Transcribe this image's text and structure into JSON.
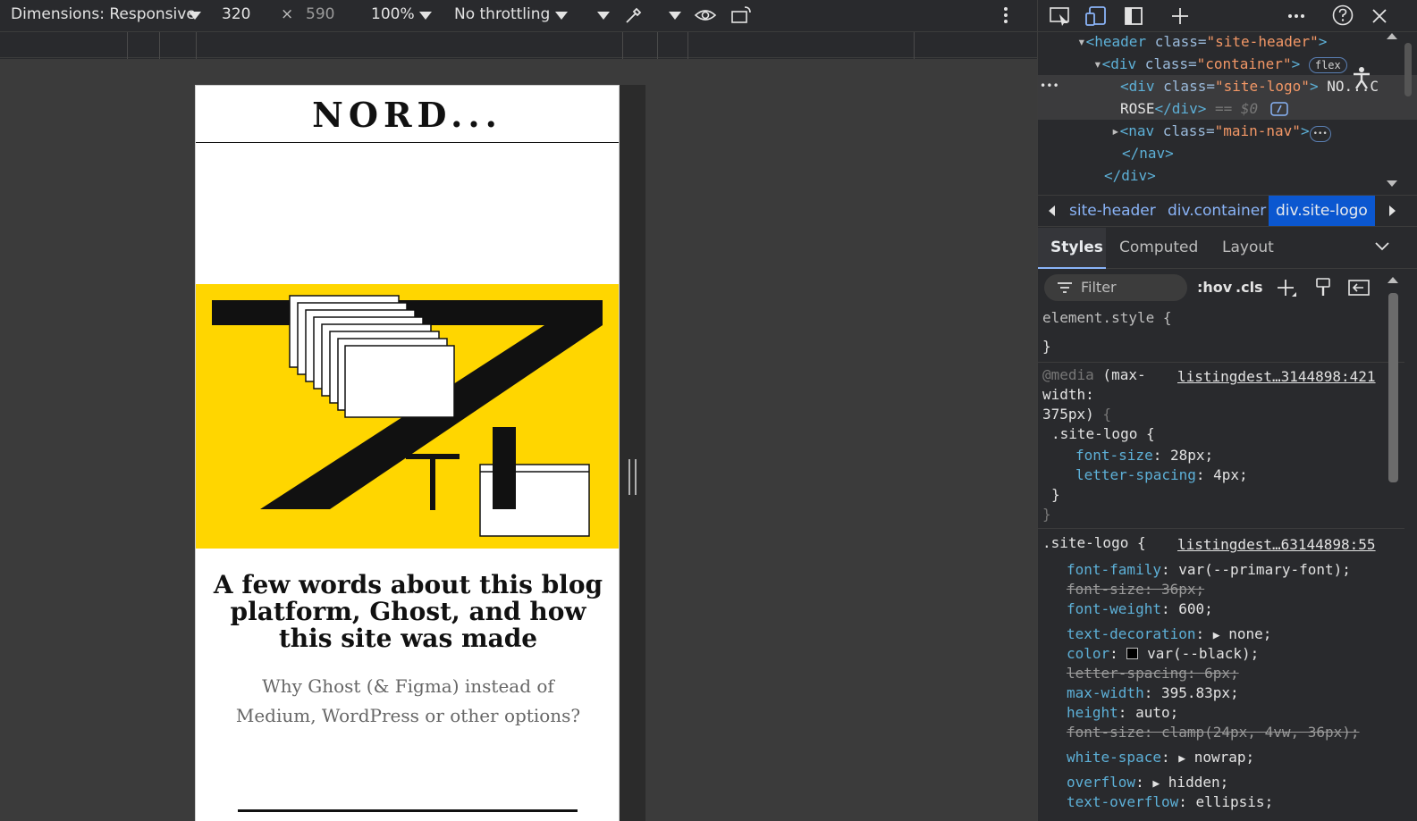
{
  "device_toolbar": {
    "dimensions_label": "Dimensions: Responsive",
    "width_value": "320",
    "times": "×",
    "height_value": "590",
    "zoom": "100%",
    "throttling": "No throttling"
  },
  "page": {
    "logo": "NORD...",
    "post_title": "A few words about this blog platform, Ghost, and how this site was made",
    "post_subtitle": "Why Ghost (& Figma) instead of Medium, WordPress or other options?"
  },
  "devtools": {
    "elements": {
      "line1_tag": "<header",
      "line1_attr": " class=",
      "line1_val": "\"site-header\"",
      "line1_end": ">",
      "line2_tag": "<div",
      "line2_attr": " class=",
      "line2_val": "\"container\"",
      "line2_end": ">",
      "line2_badge": "flex",
      "line3_tag": "<div",
      "line3_attr": " class=",
      "line3_val": "\"site-logo\"",
      "line3_end": ">",
      "line3_text": " NO...C",
      "line4_text": "ROSE",
      "line4_close": "</div>",
      "line4_eq": " == $0",
      "line5_tag": "<nav",
      "line5_attr": " class=",
      "line5_val": "\"main-nav\"",
      "line5_end": ">",
      "line5_badge": "•••",
      "line6_close": "</nav>",
      "line7_close": "</div>",
      "gutter_dots": "•••"
    },
    "breadcrumbs": [
      "site-header",
      "div.container",
      "div.site-logo"
    ],
    "style_tabs": [
      "Styles",
      "Computed",
      "Layout"
    ],
    "filter_placeholder": "Filter",
    "hov": ":hov",
    "cls": ".cls",
    "rules": {
      "element_style": "element.style {",
      "close_brace": "}",
      "media_prefix": "@media",
      "media_q1": " (max-",
      "media_q2": "width:",
      "media_q3": "375px)",
      "media_open": " {",
      "media_source": "listingdest…3144898:421",
      "media_selector": ".site-logo {",
      "media_props": [
        {
          "name": "font-size",
          "value": "28px;"
        },
        {
          "name": "letter-spacing",
          "value": "4px;"
        }
      ],
      "inner_close": "}",
      "outer_close": "}",
      "rule2_selector": ".site-logo {",
      "rule2_source": "listingdest…63144898:55",
      "rule2_props": [
        {
          "name": "font-family",
          "value": "var(--primary-font);",
          "struck": false
        },
        {
          "name": "font-size",
          "value": "36px;",
          "struck": true
        },
        {
          "name": "font-weight",
          "value": "600;",
          "struck": false
        },
        {
          "name": "text-decoration",
          "value": "none;",
          "struck": false
        },
        {
          "name": "color",
          "value": "var(--black);",
          "struck": false
        },
        {
          "name": "letter-spacing",
          "value": "6px;",
          "struck": true
        },
        {
          "name": "max-width",
          "value": "395.83px;",
          "struck": false
        },
        {
          "name": "height",
          "value": "auto;",
          "struck": false
        },
        {
          "name": "font-size",
          "value": "clamp(24px, 4vw, 36px);",
          "struck": true
        },
        {
          "name": "white-space",
          "value": "nowrap;",
          "struck": false
        },
        {
          "name": "overflow",
          "value": "hidden;",
          "struck": false
        },
        {
          "name": "text-overflow",
          "value": "ellipsis;",
          "struck": false
        }
      ]
    }
  },
  "colors": {
    "hero_yellow": "#ffd600",
    "selection_blue": "#0b57d0",
    "link_blue": "#8ab4f8",
    "property_cyan": "#5db0d7"
  }
}
